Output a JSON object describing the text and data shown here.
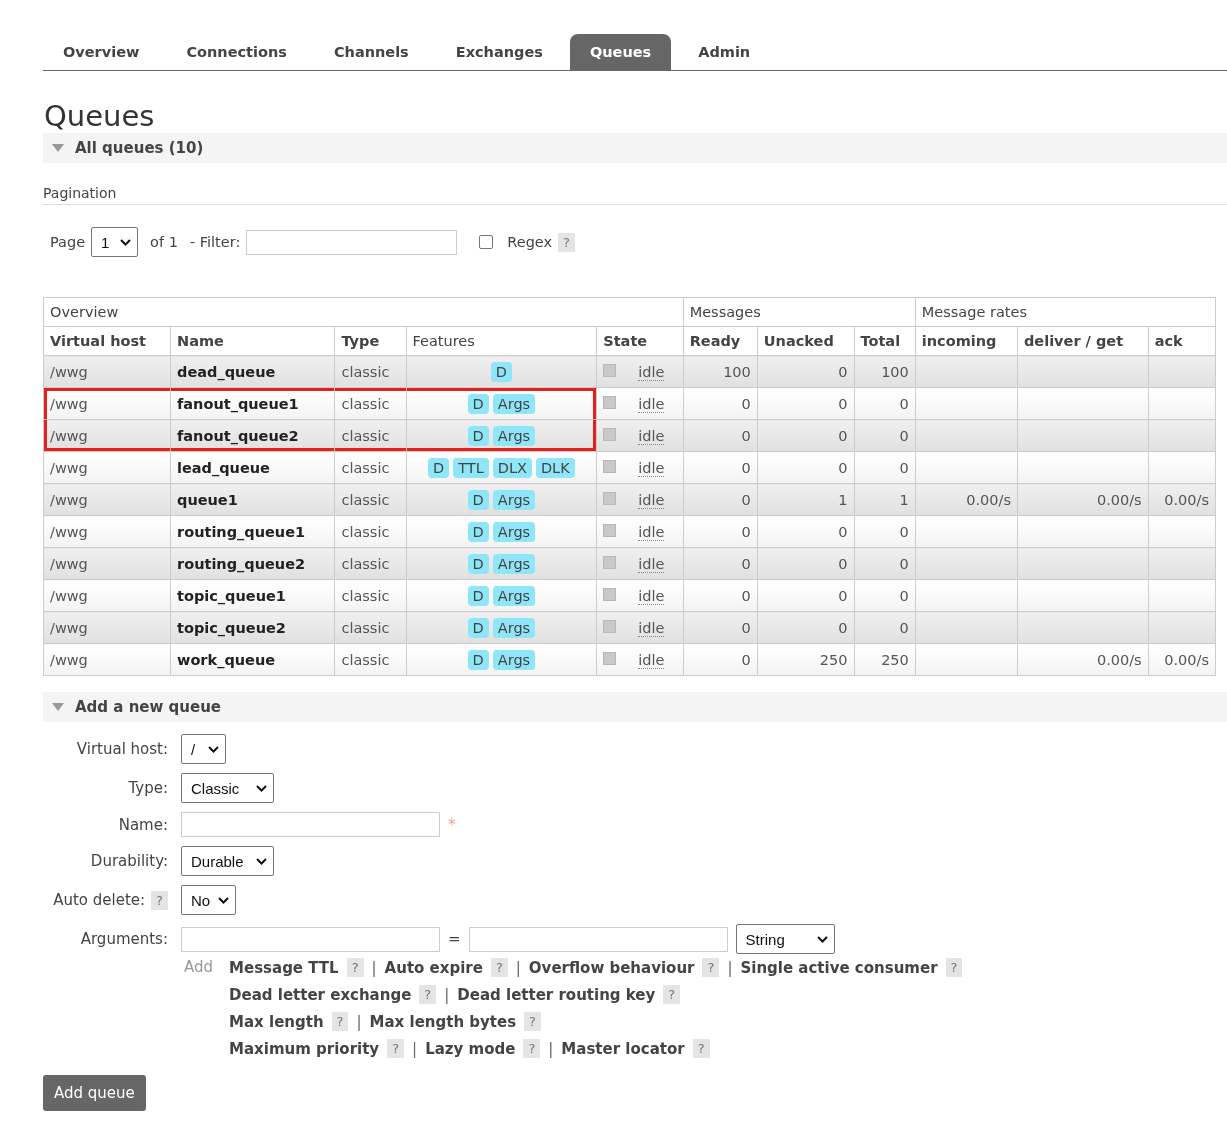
{
  "tabs": [
    {
      "label": "Overview",
      "selected": false
    },
    {
      "label": "Connections",
      "selected": false
    },
    {
      "label": "Channels",
      "selected": false
    },
    {
      "label": "Exchanges",
      "selected": false
    },
    {
      "label": "Queues",
      "selected": true
    },
    {
      "label": "Admin",
      "selected": false
    }
  ],
  "page_title": "Queues",
  "section": {
    "title": "All queues (10)",
    "expanded": true
  },
  "pagination": {
    "heading": "Pagination",
    "page_label": "Page",
    "page_value": "1",
    "of_label": "of 1",
    "filter_label": "- Filter:",
    "regex_label": "Regex",
    "regex_checked": false,
    "help": "?"
  },
  "table": {
    "groups": [
      {
        "label": "Overview"
      },
      {
        "label": "Messages"
      },
      {
        "label": "Message rates"
      }
    ],
    "columns": [
      {
        "label": "Virtual host",
        "bold": true
      },
      {
        "label": "Name",
        "bold": true
      },
      {
        "label": "Type",
        "bold": true
      },
      {
        "label": "Features",
        "bold": false
      },
      {
        "label": "State",
        "bold": true
      },
      {
        "label": "Ready",
        "bold": true
      },
      {
        "label": "Unacked",
        "bold": true
      },
      {
        "label": "Total",
        "bold": true
      },
      {
        "label": "incoming",
        "bold": true
      },
      {
        "label": "deliver / get",
        "bold": true
      },
      {
        "label": "ack",
        "bold": true
      }
    ],
    "rows": [
      {
        "vhost": "/wwg",
        "name": "dead_queue",
        "type": "classic",
        "features": [
          "D"
        ],
        "state": "idle",
        "ready": "100",
        "unacked": "0",
        "total": "100",
        "highlighted": false
      },
      {
        "vhost": "/wwg",
        "name": "fanout_queue1",
        "type": "classic",
        "features": [
          "D",
          "Args"
        ],
        "state": "idle",
        "ready": "0",
        "unacked": "0",
        "total": "0",
        "highlighted": true
      },
      {
        "vhost": "/wwg",
        "name": "fanout_queue2",
        "type": "classic",
        "features": [
          "D",
          "Args"
        ],
        "state": "idle",
        "ready": "0",
        "unacked": "0",
        "total": "0",
        "highlighted": true
      },
      {
        "vhost": "/wwg",
        "name": "lead_queue",
        "type": "classic",
        "features": [
          "D",
          "TTL",
          "DLX",
          "DLK"
        ],
        "state": "idle",
        "ready": "0",
        "unacked": "0",
        "total": "0",
        "highlighted": false
      },
      {
        "vhost": "/wwg",
        "name": "queue1",
        "type": "classic",
        "features": [
          "D",
          "Args"
        ],
        "state": "idle",
        "ready": "0",
        "unacked": "1",
        "total": "1",
        "incoming": "0.00/s",
        "deliver": "0.00/s",
        "ack": "0.00/s",
        "highlighted": false
      },
      {
        "vhost": "/wwg",
        "name": "routing_queue1",
        "type": "classic",
        "features": [
          "D",
          "Args"
        ],
        "state": "idle",
        "ready": "0",
        "unacked": "0",
        "total": "0",
        "highlighted": false
      },
      {
        "vhost": "/wwg",
        "name": "routing_queue2",
        "type": "classic",
        "features": [
          "D",
          "Args"
        ],
        "state": "idle",
        "ready": "0",
        "unacked": "0",
        "total": "0",
        "highlighted": false
      },
      {
        "vhost": "/wwg",
        "name": "topic_queue1",
        "type": "classic",
        "features": [
          "D",
          "Args"
        ],
        "state": "idle",
        "ready": "0",
        "unacked": "0",
        "total": "0",
        "highlighted": false
      },
      {
        "vhost": "/wwg",
        "name": "topic_queue2",
        "type": "classic",
        "features": [
          "D",
          "Args"
        ],
        "state": "idle",
        "ready": "0",
        "unacked": "0",
        "total": "0",
        "highlighted": false
      },
      {
        "vhost": "/wwg",
        "name": "work_queue",
        "type": "classic",
        "features": [
          "D",
          "Args"
        ],
        "state": "idle",
        "ready": "0",
        "unacked": "250",
        "total": "250",
        "deliver": "0.00/s",
        "ack": "0.00/s",
        "highlighted": false
      }
    ]
  },
  "add_section": {
    "title": "Add a new queue",
    "expanded": true
  },
  "form": {
    "fields": [
      {
        "kind": "select",
        "label": "Virtual host:",
        "value": "/"
      },
      {
        "kind": "select",
        "label": "Type:",
        "value": "Classic"
      },
      {
        "kind": "text",
        "label": "Name:",
        "required_mark": "*"
      },
      {
        "kind": "select",
        "label": "Durability:",
        "value": "Durable"
      },
      {
        "kind": "select",
        "label": "Auto delete:",
        "value": "No",
        "help": "?"
      },
      {
        "kind": "args",
        "label": "Arguments:",
        "equals": "=",
        "value": "String"
      }
    ],
    "add_label": "Add",
    "arg_lines": [
      [
        {
          "label": "Message TTL",
          "help": "?"
        },
        {
          "label": "Auto expire",
          "help": "?"
        },
        {
          "label": "Overflow behaviour",
          "help": "?"
        },
        {
          "label": "Single active consumer",
          "help": "?"
        }
      ],
      [
        {
          "label": "Dead letter exchange",
          "help": "?"
        },
        {
          "label": "Dead letter routing key",
          "help": "?"
        }
      ],
      [
        {
          "label": "Max length",
          "help": "?"
        },
        {
          "label": "Max length bytes",
          "help": "?"
        }
      ],
      [
        {
          "label": "Maximum priority",
          "help": "?"
        },
        {
          "label": "Lazy mode",
          "help": "?"
        },
        {
          "label": "Master locator",
          "help": "?"
        }
      ]
    ],
    "separator": "|",
    "submit": "Add queue"
  }
}
